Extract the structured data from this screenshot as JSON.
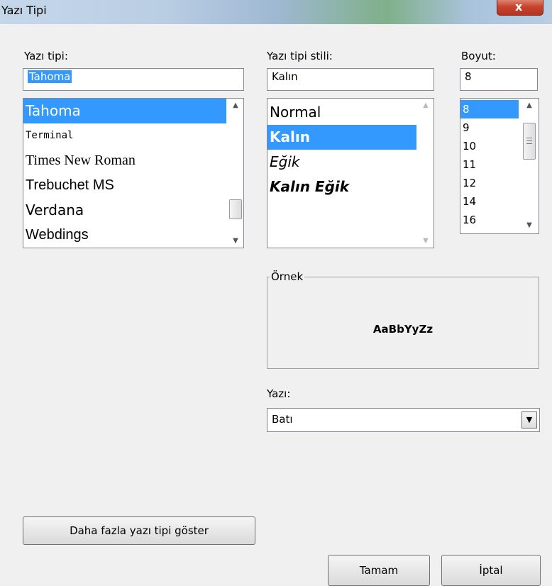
{
  "window": {
    "title": "Yazı Tipi",
    "close_symbol": "x"
  },
  "font": {
    "label": "Yazı tipi:",
    "input_value": "Tahoma",
    "items": [
      {
        "label": "Tahoma",
        "family": "\"DejaVu Sans\", sans-serif",
        "style": "normal",
        "weight": "normal"
      },
      {
        "label": "Terminal",
        "family": "\"DejaVu Sans Mono\", monospace",
        "style": "normal",
        "weight": "normal"
      },
      {
        "label": "Times New Roman",
        "family": "\"Liberation Serif\", serif",
        "style": "normal",
        "weight": "normal"
      },
      {
        "label": "Trebuchet MS",
        "family": "\"Liberation Sans\", sans-serif",
        "style": "normal",
        "weight": "normal"
      },
      {
        "label": "Verdana",
        "family": "\"DejaVu Sans\", sans-serif",
        "style": "normal",
        "weight": "normal"
      },
      {
        "label": "Webdings",
        "family": "\"Liberation Sans\", sans-serif",
        "style": "normal",
        "weight": "normal"
      }
    ],
    "selected_index": 0
  },
  "style": {
    "label": "Yazı tipi stili:",
    "input_value": "Kalın",
    "items": [
      {
        "label": "Normal",
        "style": "normal",
        "weight": "normal"
      },
      {
        "label": "Kalın",
        "style": "normal",
        "weight": "bold"
      },
      {
        "label": "Eğik",
        "style": "italic",
        "weight": "normal"
      },
      {
        "label": "Kalın Eğik",
        "style": "italic",
        "weight": "bold"
      }
    ],
    "selected_index": 1
  },
  "size": {
    "label": "Boyut:",
    "input_value": "8",
    "items": [
      "8",
      "9",
      "10",
      "11",
      "12",
      "14",
      "16"
    ],
    "selected_index": 0
  },
  "sample": {
    "label": "Örnek",
    "text": "AaBbYyZz"
  },
  "script": {
    "label": "Yazı:",
    "value": "Batı"
  },
  "buttons": {
    "more_fonts": "Daha fazla yazı tipi göster",
    "ok": "Tamam",
    "cancel": "İptal"
  },
  "colors": {
    "selection": "#3399ff",
    "title_close": "#c7442e"
  }
}
